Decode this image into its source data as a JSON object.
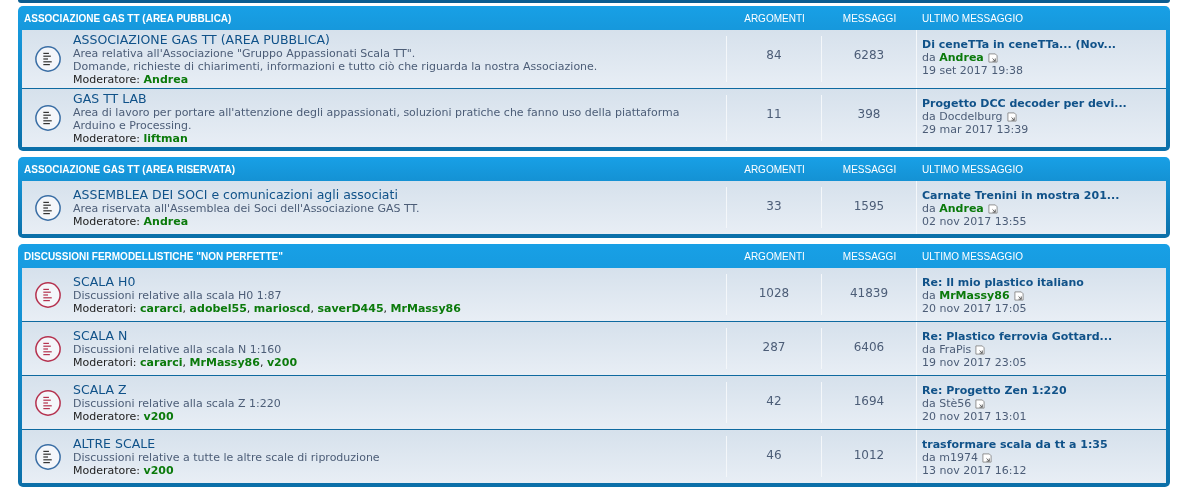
{
  "categories": [
    {
      "title": "ASSOCIAZIONE GAS TT (AREA PUBBLICA)",
      "columns": [
        "ARGOMENTI",
        "MESSAGGI",
        "ULTIMO MESSAGGIO"
      ],
      "forums": [
        {
          "title": "ASSOCIAZIONE GAS TT (AREA PUBBLICA)",
          "unread": false,
          "description": [
            "Area relativa all'Associazione \"Gruppo Appassionati Scala TT\".",
            "Domande, richieste di chiarimenti, informazioni e tutto ciò che riguarda la nostra Associazione."
          ],
          "moderators": "Moderatore: **Andrea**",
          "topics": "84",
          "posts": "6283",
          "last_title": "Di ceneTTa in ceneTTa... (Nov...",
          "last_author": "da **Andrea**",
          "last_date": "19 set 2017 19:38"
        },
        {
          "title": "GAS TT LAB",
          "unread": false,
          "description": [
            "Area di lavoro per portare all'attenzione degli appassionati, soluzioni pratiche che fanno uso della piattaforma",
            "Arduino e Processing."
          ],
          "moderators": "Moderatore: **liftman**",
          "topics": "11",
          "posts": "398",
          "last_title": "Progetto DCC decoder per devi...",
          "last_author": "da Docdelburg",
          "last_date": "29 mar 2017 13:39"
        }
      ]
    },
    {
      "title": "ASSOCIAZIONE GAS TT (AREA RISERVATA)",
      "columns": [
        "ARGOMENTI",
        "MESSAGGI",
        "ULTIMO MESSAGGIO"
      ],
      "forums": [
        {
          "title": "ASSEMBLEA DEI SOCI e comunicazioni agli associati",
          "unread": false,
          "description": [
            "Area riservata all'Assemblea dei Soci dell'Associazione GAS TT."
          ],
          "moderators": "Moderatore: **Andrea**",
          "topics": "33",
          "posts": "1595",
          "last_title": "Carnate Trenini in mostra 201...",
          "last_author": "da **Andrea**",
          "last_date": "02 nov 2017 13:55"
        }
      ]
    },
    {
      "title": "DISCUSSIONI FERMODELLISTICHE \"NON PERFETTE\"",
      "columns": [
        "ARGOMENTI",
        "MESSAGGI",
        "ULTIMO MESSAGGIO"
      ],
      "forums": [
        {
          "title": "SCALA H0",
          "unread": true,
          "description": [
            "Discussioni relative alla scala H0 1:87"
          ],
          "moderators": "Moderatori: **cararci**, **adobel55**, **marioscd**, **saverD445**, **MrMassy86**",
          "topics": "1028",
          "posts": "41839",
          "last_title": "Re: Il mio plastico italiano",
          "last_author": "da **MrMassy86**",
          "last_date": "20 nov 2017 17:05"
        },
        {
          "title": "SCALA N",
          "unread": true,
          "description": [
            "Discussioni relative alla scala N 1:160"
          ],
          "moderators": "Moderatori: **cararci**, **MrMassy86**, **v200**",
          "topics": "287",
          "posts": "6406",
          "last_title": "Re: Plastico ferrovia Gottard...",
          "last_author": "da FraPis",
          "last_date": "19 nov 2017 23:05"
        },
        {
          "title": "SCALA Z",
          "unread": true,
          "description": [
            "Discussioni relative alla scala Z 1:220"
          ],
          "moderators": "Moderatore: **v200**",
          "topics": "42",
          "posts": "1694",
          "last_title": "Re: Progetto Zen 1:220",
          "last_author": "da Stè56",
          "last_date": "20 nov 2017 13:01"
        },
        {
          "title": "ALTRE SCALE",
          "unread": false,
          "description": [
            "Discussioni relative a tutte le altre scale di riproduzione"
          ],
          "moderators": "Moderatore: **v200**",
          "topics": "46",
          "posts": "1012",
          "last_title": "trasformare scala da tt a 1:35",
          "last_author": "da m1974",
          "last_date": "13 nov 2017 16:12"
        }
      ]
    }
  ]
}
